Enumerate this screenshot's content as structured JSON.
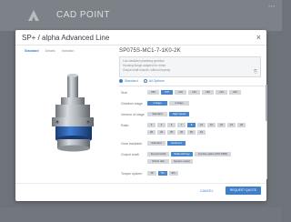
{
  "app": {
    "brand": "CAD POINT"
  },
  "modal": {
    "title": "SP+ / alpha Advanced Line",
    "close": "×",
    "tabs": [
      {
        "label": "Standard",
        "active": true
      },
      {
        "label": "Details",
        "active": false
      },
      {
        "label": "Variation",
        "active": false
      }
    ],
    "config_code": "SP075S-MC1-7-1K0-2K",
    "description": [
      "Low-backlash planetary gearbox",
      "Housing flange adapted for motor",
      "Output shaft smooth, without keyway"
    ],
    "view": {
      "options": [
        {
          "label": "Standard",
          "selected": true
        },
        {
          "label": "All Options",
          "selected": false
        }
      ]
    },
    "params": [
      {
        "label": "Size",
        "options": [
          {
            "label": "060",
            "selected": false
          },
          {
            "label": "075",
            "selected": true
          },
          {
            "label": "100",
            "selected": false
          },
          {
            "label": "140",
            "selected": false
          },
          {
            "label": "180",
            "selected": false
          },
          {
            "label": "210",
            "selected": false
          },
          {
            "label": "240",
            "selected": false
          }
        ]
      },
      {
        "label": "Gearbox stage",
        "options": [
          {
            "label": "1-stage",
            "selected": true
          },
          {
            "label": "2-stage",
            "selected": false
          }
        ]
      },
      {
        "label": "Version of stage",
        "options": [
          {
            "label": "Standard",
            "selected": false
          },
          {
            "label": "High speed",
            "selected": true
          }
        ]
      },
      {
        "label": "Ratio",
        "options": [
          {
            "label": "3",
            "selected": false
          },
          {
            "label": "4",
            "selected": false
          },
          {
            "label": "5",
            "selected": false
          },
          {
            "label": "7",
            "selected": false
          },
          {
            "label": "8",
            "selected": true
          },
          {
            "label": "10",
            "selected": false
          },
          {
            "label": "16",
            "selected": false
          },
          {
            "label": "20",
            "selected": false
          },
          {
            "label": "21",
            "selected": false
          },
          {
            "label": "25",
            "selected": false
          },
          {
            "label": "28",
            "selected": false
          },
          {
            "label": "32",
            "selected": false
          },
          {
            "label": "35",
            "selected": false
          },
          {
            "label": "40",
            "selected": false
          },
          {
            "label": "50",
            "selected": false
          },
          {
            "label": "64",
            "selected": false
          }
        ]
      },
      {
        "label": "Gear backlash",
        "options": [
          {
            "label": "Standard",
            "selected": false
          },
          {
            "label": "Reduced",
            "selected": true
          }
        ]
      },
      {
        "label": "Output shaft",
        "options": [
          {
            "label": "Smooth shaft",
            "selected": false
          },
          {
            "label": "Shaft with key",
            "selected": true
          },
          {
            "label": "Involute spline (DIN 5480)",
            "selected": false
          },
          {
            "label": "Shrink disk",
            "selected": false
          },
          {
            "label": "System output",
            "selected": false
          }
        ]
      },
      {
        "label": "Torque system",
        "options": [
          {
            "label": "TP",
            "selected": false
          },
          {
            "label": "TP+",
            "selected": true
          },
          {
            "label": "SP+",
            "selected": false
          }
        ]
      }
    ],
    "cancel_label": "CANCEL",
    "request_label": "REQUEST QUOTE"
  },
  "colors": {
    "accent": "#3f7ec9",
    "selected": "#4a86cd",
    "overlay": "#6e7379",
    "modal_bg": "#ffffff"
  }
}
